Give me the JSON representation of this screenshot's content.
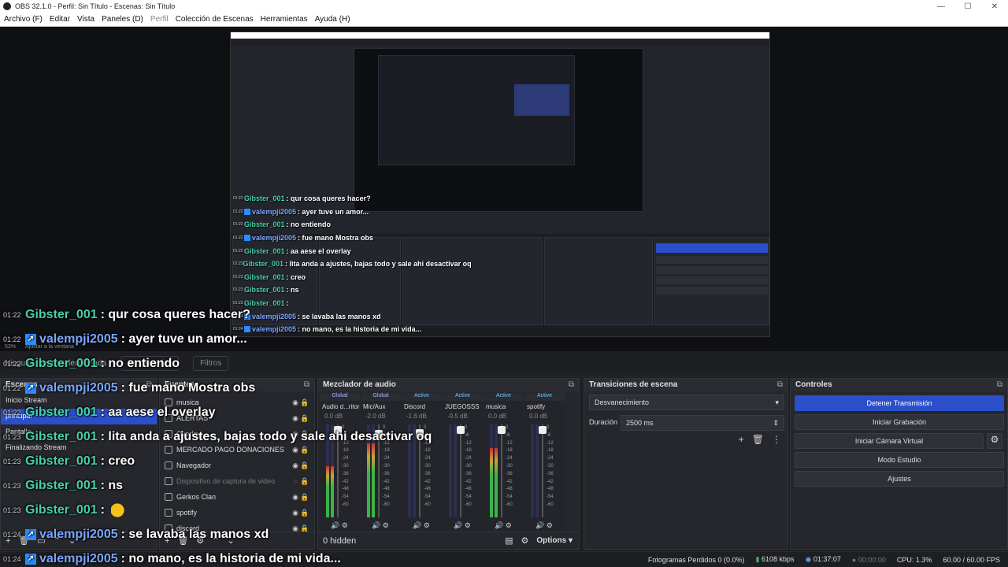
{
  "window": {
    "title": "OBS 32.1.0 - Perfil: Sin Título - Escenas: Sin Título",
    "controls": [
      "—",
      "☐",
      "✕"
    ]
  },
  "menu": [
    "Archivo (F)",
    "Editar",
    "Vista",
    "Paneles (D)",
    "Perfil",
    "Colección de Escenas",
    "Herramientas",
    "Ayuda (H)"
  ],
  "zoom": {
    "level": "53%",
    "fit": "Ajustar a la ventana"
  },
  "source_toolbar": {
    "no_source": "Ninguna fuente seleccionada",
    "properties": "Propiedades",
    "filters": "Filtros"
  },
  "scenes": {
    "title": "Escenas",
    "items": [
      "Inicio Stream",
      "principal",
      "Pantalla",
      "Finalizando Stream"
    ]
  },
  "sources": {
    "title": "Fuentes",
    "items": [
      "musica",
      "ALERTAS",
      "Overlay",
      "MERCADO PAGO DONACIONES",
      "Navegador",
      "Dispositivo de captura de video",
      "Gerkos Clan",
      "spotify",
      "discord"
    ]
  },
  "mixer": {
    "title": "Mezclador de audio",
    "channels": [
      {
        "tag": "Global",
        "name": "Audio d...ritorio",
        "db": "0.0 dB",
        "level": 0.55,
        "knob": 0.02
      },
      {
        "tag": "Global",
        "name": "Mic/Aux",
        "db": "-2.0 dB",
        "level": 0.8,
        "knob": 0.06
      },
      {
        "tag": "Active",
        "name": "Discord",
        "db": "-1.6 dB",
        "level": 0.0,
        "knob": 0.05
      },
      {
        "tag": "Active",
        "name": "JUEGOSSS",
        "db": "-0.5 dB",
        "level": 0.0,
        "knob": 0.02
      },
      {
        "tag": "Active",
        "name": "musica",
        "db": "0.0 dB",
        "level": 0.75,
        "knob": 0.02
      },
      {
        "tag": "Active",
        "name": "spotify",
        "db": "0.0 dB",
        "level": 0.0,
        "knob": 0.02
      }
    ],
    "scale": [
      "0",
      "-6",
      "-12",
      "-18",
      "-24",
      "-30",
      "-36",
      "-42",
      "-48",
      "-54",
      "-60"
    ],
    "hidden": "0 hidden",
    "options": "Options"
  },
  "transitions": {
    "title": "Transiciones de escena",
    "selected": "Desvanecimiento",
    "duration_label": "Duración",
    "duration": "2500 ms"
  },
  "controls": {
    "title": "Controles",
    "stop_stream": "Detener Transmisión",
    "start_recording": "Iniciar Grabación",
    "start_virtual_cam": "Iniciar Cámara Virtual",
    "studio_mode": "Modo Estudio",
    "settings": "Ajustes"
  },
  "status": {
    "dropped_frames": "Fotogramas Perdidos 0 (0.0%)",
    "bitrate": "6108 kbps",
    "stream_time": "01:37:07",
    "rec_time": "00:00:00",
    "cpu": "CPU: 1.3%",
    "fps": "60.00 / 60.00 FPS"
  },
  "chat": [
    {
      "time": "01:22",
      "user": "Gibster_001",
      "type": "g",
      "msg": ": qur cosa queres hacer?"
    },
    {
      "time": "01:22",
      "user": "valempji2005",
      "type": "b",
      "msg": ": ayer tuve un amor..."
    },
    {
      "time": "01:22",
      "user": "Gibster_001",
      "type": "g",
      "msg": ": no entiendo"
    },
    {
      "time": "01:22",
      "user": "valempji2005",
      "type": "b",
      "msg": ": fue mano Mostra obs"
    },
    {
      "time": "01:22",
      "user": "Gibster_001",
      "type": "g",
      "msg": ": aa aese el overlay"
    },
    {
      "time": "01:23",
      "user": "Gibster_001",
      "type": "g",
      "msg": ": lita anda a ajustes, bajas todo y sale ahi desactivar oq"
    },
    {
      "time": "01:23",
      "user": "Gibster_001",
      "type": "g",
      "msg": ": creo"
    },
    {
      "time": "01:23",
      "user": "Gibster_001",
      "type": "g",
      "msg": ": ns"
    },
    {
      "time": "01:23",
      "user": "Gibster_001",
      "type": "g",
      "msg": ":",
      "emote": true
    },
    {
      "time": "01:24",
      "user": "valempji2005",
      "type": "b",
      "msg": ": se lavaba las manos xd"
    },
    {
      "time": "01:24",
      "user": "valempji2005",
      "type": "b",
      "msg": ": no mano, es la historia de mi vida..."
    }
  ]
}
